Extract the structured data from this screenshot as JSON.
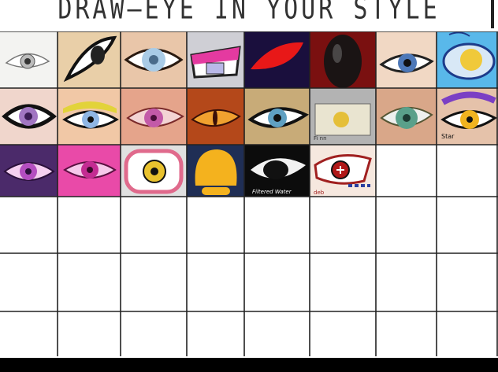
{
  "title": "DRAW—EYE IN YOUR STYLE",
  "grid": {
    "columns": 8,
    "rows": 6,
    "filled_cells": 22
  },
  "signatures": {
    "c19": "Filtered Water",
    "c22": "deb",
    "c15": "Fi nn",
    "c16": "Star"
  },
  "colors": {
    "background": "#ffffff",
    "lines": "#222222",
    "bottom_bar": "#000000"
  }
}
